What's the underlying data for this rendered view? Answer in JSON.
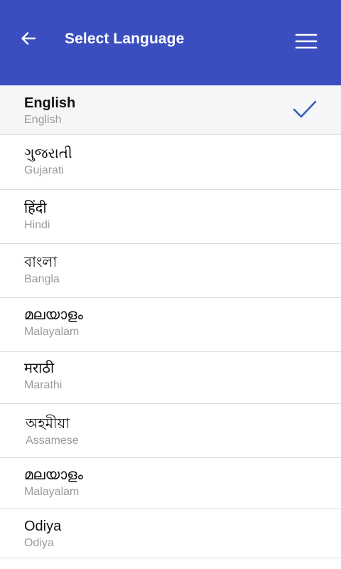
{
  "header": {
    "title": "Select Language",
    "back_icon": "arrow-left-icon",
    "menu_icon": "hamburger-menu-icon",
    "background_color": "#3a4ec0"
  },
  "languages": [
    {
      "native": "English",
      "english": "English",
      "selected": true
    },
    {
      "native": "ગુજરાતી",
      "english": "Gujarati",
      "selected": false
    },
    {
      "native": "हिंदी",
      "english": "Hindi",
      "selected": false
    },
    {
      "native": "বাংলা",
      "english": "Bangla",
      "selected": false
    },
    {
      "native": "മലയാളം",
      "english": "Malayalam",
      "selected": false
    },
    {
      "native": "मराठी",
      "english": "Marathi",
      "selected": false
    },
    {
      "native": "অহমীয়া",
      "english": "Assamese",
      "selected": false
    },
    {
      "native": "മലയാളം",
      "english": "Malayalam",
      "selected": false
    },
    {
      "native": "Odiya",
      "english": "Odiya",
      "selected": false
    }
  ],
  "selected_icon": "checkmark-icon",
  "accent_color": "#3a5bb5"
}
